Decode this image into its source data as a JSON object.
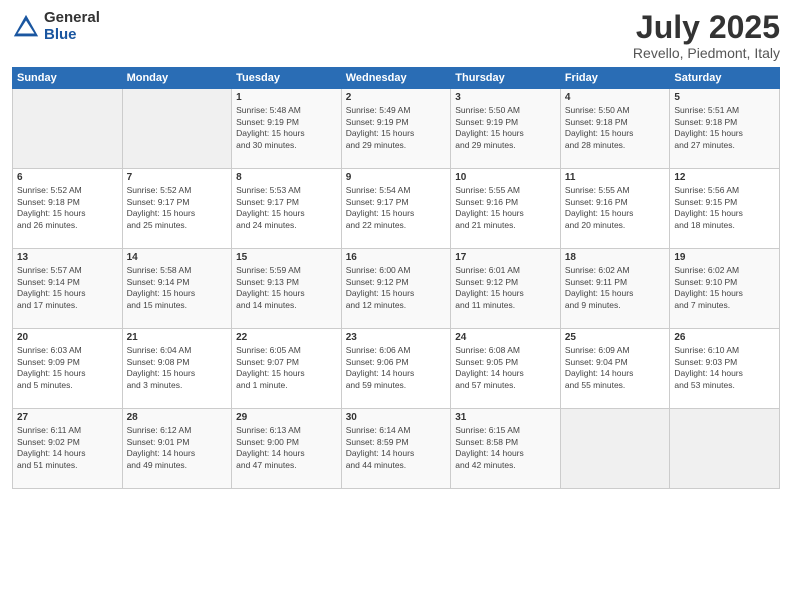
{
  "header": {
    "logo_general": "General",
    "logo_blue": "Blue",
    "title": "July 2025",
    "location": "Revello, Piedmont, Italy"
  },
  "days_of_week": [
    "Sunday",
    "Monday",
    "Tuesday",
    "Wednesday",
    "Thursday",
    "Friday",
    "Saturday"
  ],
  "weeks": [
    [
      {
        "day": "",
        "info": ""
      },
      {
        "day": "",
        "info": ""
      },
      {
        "day": "1",
        "info": "Sunrise: 5:48 AM\nSunset: 9:19 PM\nDaylight: 15 hours\nand 30 minutes."
      },
      {
        "day": "2",
        "info": "Sunrise: 5:49 AM\nSunset: 9:19 PM\nDaylight: 15 hours\nand 29 minutes."
      },
      {
        "day": "3",
        "info": "Sunrise: 5:50 AM\nSunset: 9:19 PM\nDaylight: 15 hours\nand 29 minutes."
      },
      {
        "day": "4",
        "info": "Sunrise: 5:50 AM\nSunset: 9:18 PM\nDaylight: 15 hours\nand 28 minutes."
      },
      {
        "day": "5",
        "info": "Sunrise: 5:51 AM\nSunset: 9:18 PM\nDaylight: 15 hours\nand 27 minutes."
      }
    ],
    [
      {
        "day": "6",
        "info": "Sunrise: 5:52 AM\nSunset: 9:18 PM\nDaylight: 15 hours\nand 26 minutes."
      },
      {
        "day": "7",
        "info": "Sunrise: 5:52 AM\nSunset: 9:17 PM\nDaylight: 15 hours\nand 25 minutes."
      },
      {
        "day": "8",
        "info": "Sunrise: 5:53 AM\nSunset: 9:17 PM\nDaylight: 15 hours\nand 24 minutes."
      },
      {
        "day": "9",
        "info": "Sunrise: 5:54 AM\nSunset: 9:17 PM\nDaylight: 15 hours\nand 22 minutes."
      },
      {
        "day": "10",
        "info": "Sunrise: 5:55 AM\nSunset: 9:16 PM\nDaylight: 15 hours\nand 21 minutes."
      },
      {
        "day": "11",
        "info": "Sunrise: 5:55 AM\nSunset: 9:16 PM\nDaylight: 15 hours\nand 20 minutes."
      },
      {
        "day": "12",
        "info": "Sunrise: 5:56 AM\nSunset: 9:15 PM\nDaylight: 15 hours\nand 18 minutes."
      }
    ],
    [
      {
        "day": "13",
        "info": "Sunrise: 5:57 AM\nSunset: 9:14 PM\nDaylight: 15 hours\nand 17 minutes."
      },
      {
        "day": "14",
        "info": "Sunrise: 5:58 AM\nSunset: 9:14 PM\nDaylight: 15 hours\nand 15 minutes."
      },
      {
        "day": "15",
        "info": "Sunrise: 5:59 AM\nSunset: 9:13 PM\nDaylight: 15 hours\nand 14 minutes."
      },
      {
        "day": "16",
        "info": "Sunrise: 6:00 AM\nSunset: 9:12 PM\nDaylight: 15 hours\nand 12 minutes."
      },
      {
        "day": "17",
        "info": "Sunrise: 6:01 AM\nSunset: 9:12 PM\nDaylight: 15 hours\nand 11 minutes."
      },
      {
        "day": "18",
        "info": "Sunrise: 6:02 AM\nSunset: 9:11 PM\nDaylight: 15 hours\nand 9 minutes."
      },
      {
        "day": "19",
        "info": "Sunrise: 6:02 AM\nSunset: 9:10 PM\nDaylight: 15 hours\nand 7 minutes."
      }
    ],
    [
      {
        "day": "20",
        "info": "Sunrise: 6:03 AM\nSunset: 9:09 PM\nDaylight: 15 hours\nand 5 minutes."
      },
      {
        "day": "21",
        "info": "Sunrise: 6:04 AM\nSunset: 9:08 PM\nDaylight: 15 hours\nand 3 minutes."
      },
      {
        "day": "22",
        "info": "Sunrise: 6:05 AM\nSunset: 9:07 PM\nDaylight: 15 hours\nand 1 minute."
      },
      {
        "day": "23",
        "info": "Sunrise: 6:06 AM\nSunset: 9:06 PM\nDaylight: 14 hours\nand 59 minutes."
      },
      {
        "day": "24",
        "info": "Sunrise: 6:08 AM\nSunset: 9:05 PM\nDaylight: 14 hours\nand 57 minutes."
      },
      {
        "day": "25",
        "info": "Sunrise: 6:09 AM\nSunset: 9:04 PM\nDaylight: 14 hours\nand 55 minutes."
      },
      {
        "day": "26",
        "info": "Sunrise: 6:10 AM\nSunset: 9:03 PM\nDaylight: 14 hours\nand 53 minutes."
      }
    ],
    [
      {
        "day": "27",
        "info": "Sunrise: 6:11 AM\nSunset: 9:02 PM\nDaylight: 14 hours\nand 51 minutes."
      },
      {
        "day": "28",
        "info": "Sunrise: 6:12 AM\nSunset: 9:01 PM\nDaylight: 14 hours\nand 49 minutes."
      },
      {
        "day": "29",
        "info": "Sunrise: 6:13 AM\nSunset: 9:00 PM\nDaylight: 14 hours\nand 47 minutes."
      },
      {
        "day": "30",
        "info": "Sunrise: 6:14 AM\nSunset: 8:59 PM\nDaylight: 14 hours\nand 44 minutes."
      },
      {
        "day": "31",
        "info": "Sunrise: 6:15 AM\nSunset: 8:58 PM\nDaylight: 14 hours\nand 42 minutes."
      },
      {
        "day": "",
        "info": ""
      },
      {
        "day": "",
        "info": ""
      }
    ]
  ]
}
